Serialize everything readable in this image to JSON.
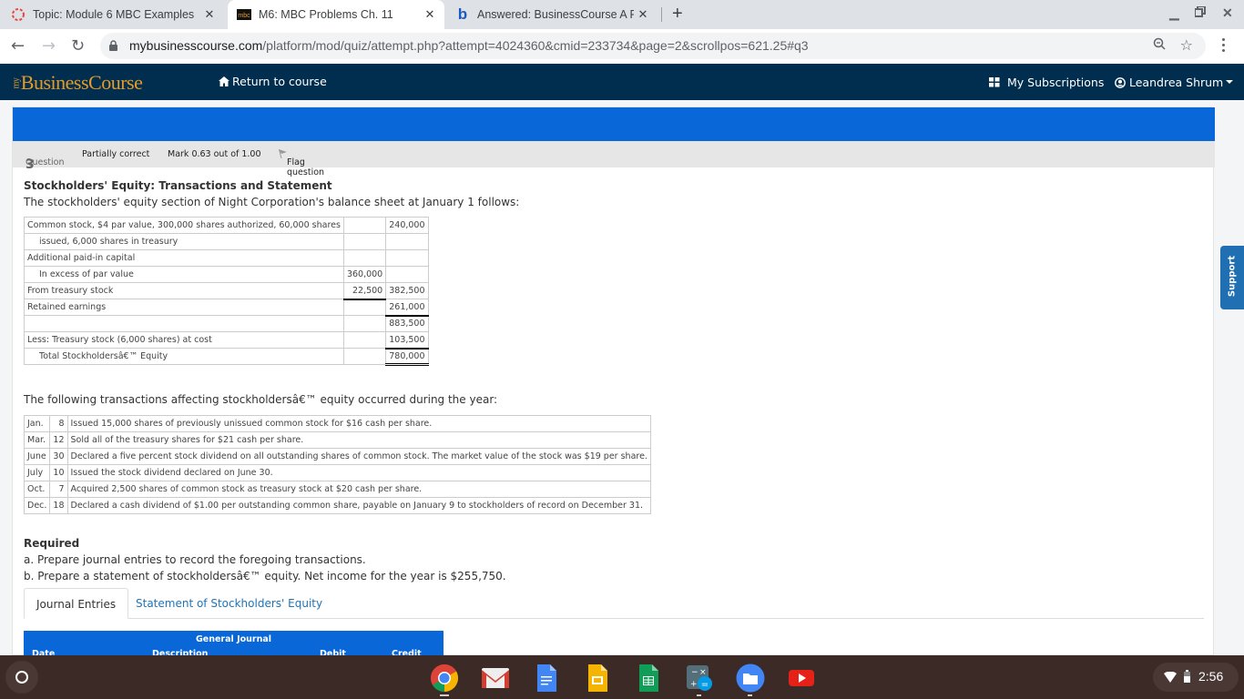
{
  "browser": {
    "tabs": [
      {
        "title": "Topic: Module 6 MBC Examples",
        "favicon": "spinner-icon",
        "active": false
      },
      {
        "title": "M6: MBC Problems Ch. 11",
        "favicon": "mbc-icon",
        "active": true
      },
      {
        "title": "Answered: BusinessCourse A Re",
        "favicon": "bartleby-icon",
        "active": false
      }
    ],
    "url_host": "mybusinesscourse.com",
    "url_path": "/platform/mod/quiz/attempt.php?attempt=4024360&cmid=233734&page=2&scrollpos=621.25#q3"
  },
  "site": {
    "logo_prefix": "my",
    "logo": "BusinessCourse",
    "return_label": "Return to course",
    "subscriptions_label": "My Subscriptions",
    "user_name": "Leandrea Shrum"
  },
  "question": {
    "label": "Question",
    "number": "3",
    "status": "Partially correct",
    "mark": "Mark 0.63 out of 1.00",
    "flag_label": "Flag question",
    "title": "Stockholders' Equity: Transactions and Statement",
    "intro": "The stockholders' equity section of Night Corporation's balance sheet at January 1 follows:",
    "balance_sheet": [
      {
        "label": "Common stock, $4 par value, 300,000 shares authorized, 60,000 shares",
        "col1": "",
        "col2": "240,000",
        "indent": false
      },
      {
        "label": "issued, 6,000 shares in treasury",
        "col1": "",
        "col2": "",
        "indent": true
      },
      {
        "label": "Additional paid-in capital",
        "col1": "",
        "col2": "",
        "indent": false
      },
      {
        "label": "In excess of par value",
        "col1": "360,000",
        "col2": "",
        "indent": true
      },
      {
        "label": "From treasury stock",
        "col1": "22,500",
        "col2": "382,500",
        "indent": false
      },
      {
        "label": "Retained earnings",
        "col1": "",
        "col2": "261,000",
        "indent": false
      },
      {
        "label": "",
        "col1": "",
        "col2": "883,500",
        "indent": false
      },
      {
        "label": "Less: Treasury stock (6,000 shares) at cost",
        "col1": "",
        "col2": "103,500",
        "indent": false
      },
      {
        "label": "Total Stockholdersâ€™ Equity",
        "col1": "",
        "col2": "780,000",
        "indent": true
      }
    ],
    "transactions_intro": "The following transactions affecting stockholdersâ€™ equity occurred during the year:",
    "transactions": [
      {
        "month": "Jan.",
        "day": "8",
        "text": "Issued 15,000 shares of previously unissued common stock for $16 cash per share."
      },
      {
        "month": "Mar.",
        "day": "12",
        "text": "Sold all of the treasury shares for $21 cash per share."
      },
      {
        "month": "June",
        "day": "30",
        "text": "Declared a five percent stock dividend on all outstanding shares of common stock. The market value of the stock was $19 per share."
      },
      {
        "month": "July",
        "day": "10",
        "text": "Issued the stock dividend declared on June 30."
      },
      {
        "month": "Oct.",
        "day": "7",
        "text": "Acquired 2,500 shares of common stock as treasury stock at $20 cash per share."
      },
      {
        "month": "Dec.",
        "day": "18",
        "text": "Declared a cash dividend of $1.00 per outstanding common share, payable on January 9 to stockholders of record on December 31."
      }
    ],
    "required_heading": "Required",
    "required_a": "a. Prepare journal entries to record the foregoing transactions.",
    "required_b": "b. Prepare a statement of stockholdersâ€™ equity. Net income for the year is $255,750.",
    "tabs": [
      "Journal Entries",
      "Statement of Stockholders' Equity"
    ],
    "journal": {
      "title": "General Journal",
      "columns": [
        "Date",
        "Description",
        "Debit",
        "Credit"
      ]
    }
  },
  "support_label": "Support",
  "shelf": {
    "apps": [
      "chrome-icon",
      "gmail-icon",
      "docs-icon",
      "slides-icon",
      "sheets-icon",
      "calculator-icon",
      "files-icon",
      "youtube-icon"
    ],
    "time": "2:56"
  }
}
